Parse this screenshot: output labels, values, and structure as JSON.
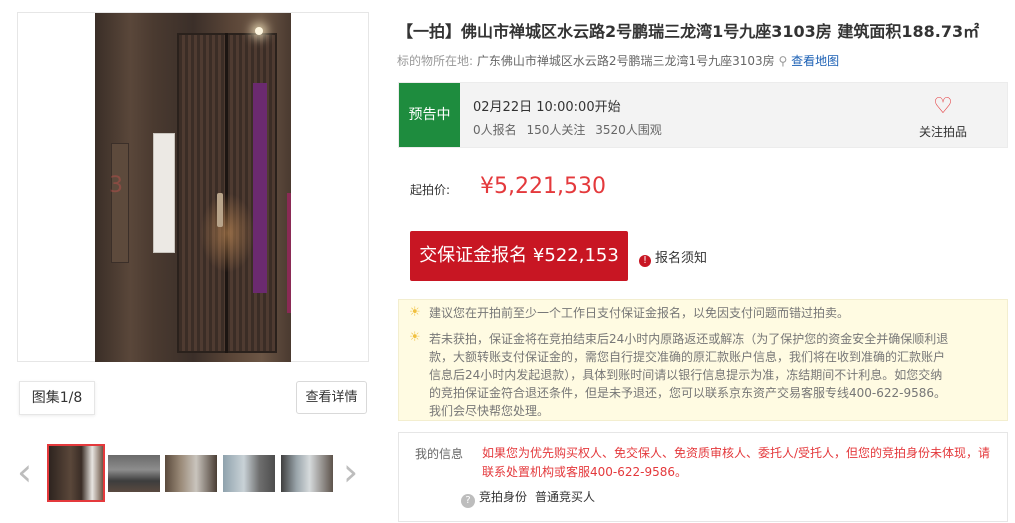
{
  "gallery": {
    "watermark": "3",
    "count_label": "图集1/8",
    "detail_button": "查看详情",
    "prev_arrow": "‹",
    "next_arrow": "›"
  },
  "listing": {
    "title": "【一拍】佛山市禅城区水云路2号鹏瑞三龙湾1号九座3103房 建筑面积188.73㎡",
    "location_label": "标的物所在地:",
    "location_value": "广东佛山市禅城区水云路2号鹏瑞三龙湾1号九座3103房",
    "map_link": "查看地图"
  },
  "status": {
    "badge": "预告中",
    "start_time": "02月22日 10:00:00开始",
    "signups": "0人报名",
    "followers": "150人关注",
    "viewers": "3520人围观",
    "follow_label": "关注拍品",
    "accent_color": "#1e8c3e"
  },
  "price": {
    "label": "起拍价:",
    "value": "¥5,221,530",
    "color": "#e4393c"
  },
  "actions": {
    "deposit_button": "交保证金报名 ¥522,153",
    "notice_link": "报名须知"
  },
  "tips": [
    "建议您在开拍前至少一个工作日支付保证金报名，以免因支付问题而错过拍卖。",
    "若未获拍，保证金将在竞拍结束后24小时内原路返还或解冻（为了保护您的资金安全并确保顺利退",
    "款，大额转账支付保证金的，需您自行提交准确的原汇款账户信息，我们将在收到准确的汇款账户",
    "信息后24小时内发起退款），具体到账时间请以银行信息提示为准，冻结期间不计利息。如您交纳",
    "的竞拍保证金符合退还条件，但是未予退还，您可以联系京东资产交易客服专线400-622-9586。",
    "我们会尽快帮您处理。"
  ],
  "my_info": {
    "label": "我的信息",
    "warning": "如果您为优先购买权人、免交保人、免资质审核人、委托人/受托人，但您的竞拍身份未体现，请联系处置机构或客服400-622-9586。",
    "role_label": "竞拍身份",
    "role_value": "普通竞买人"
  }
}
